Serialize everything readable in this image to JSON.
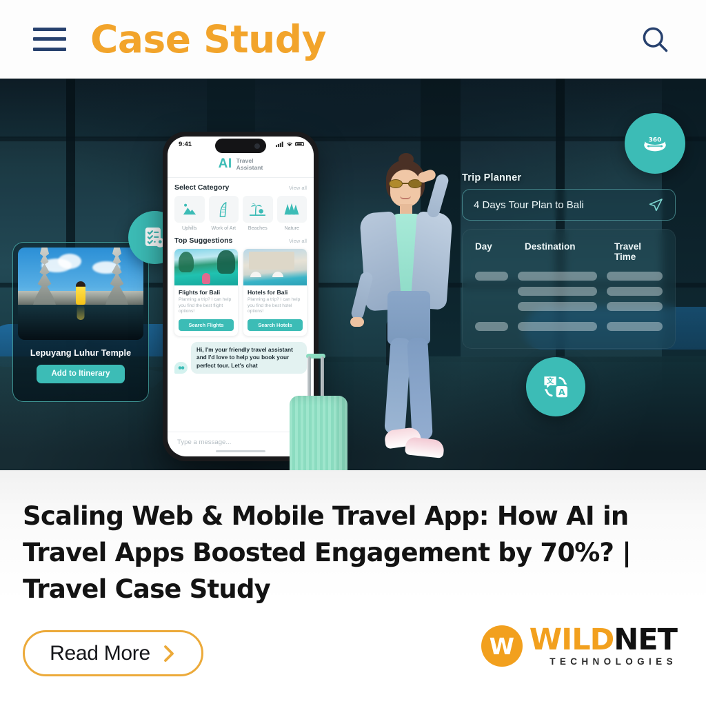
{
  "header": {
    "title": "Case Study",
    "menu_icon": "hamburger-menu-icon",
    "search_icon": "search-icon",
    "title_color": "#f2a42b",
    "icon_color": "#27416e"
  },
  "hero": {
    "accent_color": "#3cbcb6",
    "background_desc": "airport-terminal-interior",
    "badges": [
      {
        "name": "itinerary-checklist-badge",
        "icon": "checklist-location-icon",
        "label": ""
      },
      {
        "name": "three-sixty-view-badge",
        "icon": "360-view-icon",
        "label": "360"
      },
      {
        "name": "translate-badge",
        "icon": "translate-icon",
        "label": ""
      }
    ],
    "temple_card": {
      "name": "Lepuyang Luhur Temple",
      "button": "Add to Itinerary"
    },
    "phone": {
      "status": {
        "time": "9:41",
        "signal": "signal-icon",
        "wifi": "wifi-icon",
        "battery": "battery-icon"
      },
      "app_name_mark": "AI",
      "app_name_sub_line1": "Travel",
      "app_name_sub_line2": "Assistant",
      "sections": [
        {
          "title": "Select Category",
          "action": "View all"
        },
        {
          "title": "Top Suggestions",
          "action": "View all"
        }
      ],
      "categories": [
        {
          "label": "Uphills",
          "icon": "mountain-icon"
        },
        {
          "label": "Work of Art",
          "icon": "landmark-building-icon"
        },
        {
          "label": "Beaches",
          "icon": "palm-beach-icon"
        },
        {
          "label": "Nature",
          "icon": "forest-trees-icon"
        }
      ],
      "suggestions": [
        {
          "title": "Flights for Bali",
          "desc": "Planning a trip? I can help you find the best flight options!",
          "button": "Search Flights",
          "image": "bali-river-boat-photo"
        },
        {
          "title": "Hotels for Bali",
          "desc": "Planning a trip? I can help you find the best hotel options!",
          "button": "Search Hotels",
          "image": "hotel-poolside-photo"
        }
      ],
      "chat_message": "Hi, I'm your friendly travel assistant and I'd love to help you book your perfect tour. Let's chat",
      "chat_avatar_icon": "chat-bubble-icon",
      "input_placeholder": "Type a message..."
    },
    "planner": {
      "label": "Trip Planner",
      "query": "4 Days Tour Plan to Bali",
      "send_icon": "send-paper-plane-icon",
      "columns": [
        "Day",
        "Destination",
        "Travel Time"
      ],
      "skeleton_rows": 4
    }
  },
  "content": {
    "headline": "Scaling Web & Mobile Travel App: How AI in Travel Apps Boosted Engagement by 70%? | Travel Case Study",
    "read_more": {
      "label": "Read More",
      "icon": "chevron-right-icon",
      "border_color": "#ecaa3a"
    },
    "logo": {
      "badge_letter": "W",
      "word_primary": "WILD",
      "word_secondary": "NET",
      "tagline": "TECHNOLOGIES",
      "primary_color": "#f2a01e",
      "secondary_color": "#111111"
    }
  }
}
